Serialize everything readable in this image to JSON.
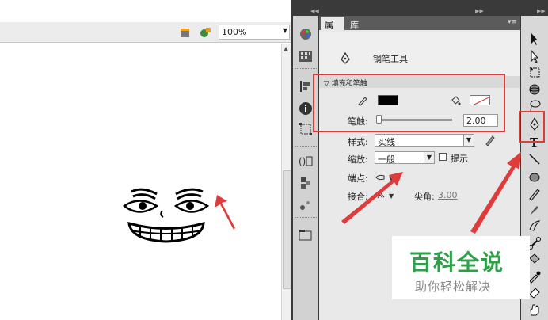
{
  "stage": {
    "zoom": "100%"
  },
  "panel": {
    "tabs": [
      "属性",
      "库"
    ],
    "tool_name": "钢笔工具",
    "section_title": "填充和笔触",
    "stroke_label": "笔触:",
    "stroke_value": "2.00",
    "style_label": "样式:",
    "style_value": "实线",
    "scale_label": "缩放:",
    "scale_value": "一般",
    "hint_label": "提示",
    "cap_label": "端点:",
    "join_label": "接合:",
    "miter_label": "尖角:",
    "miter_value": "3.00",
    "stroke_color": "#000000",
    "fill_color": "none"
  },
  "watermark": {
    "title": "百科全说",
    "subtitle": "助你轻松解决"
  },
  "colors": {
    "annotation_red": "#e03b3b",
    "brand_green": "#2ea04a"
  }
}
